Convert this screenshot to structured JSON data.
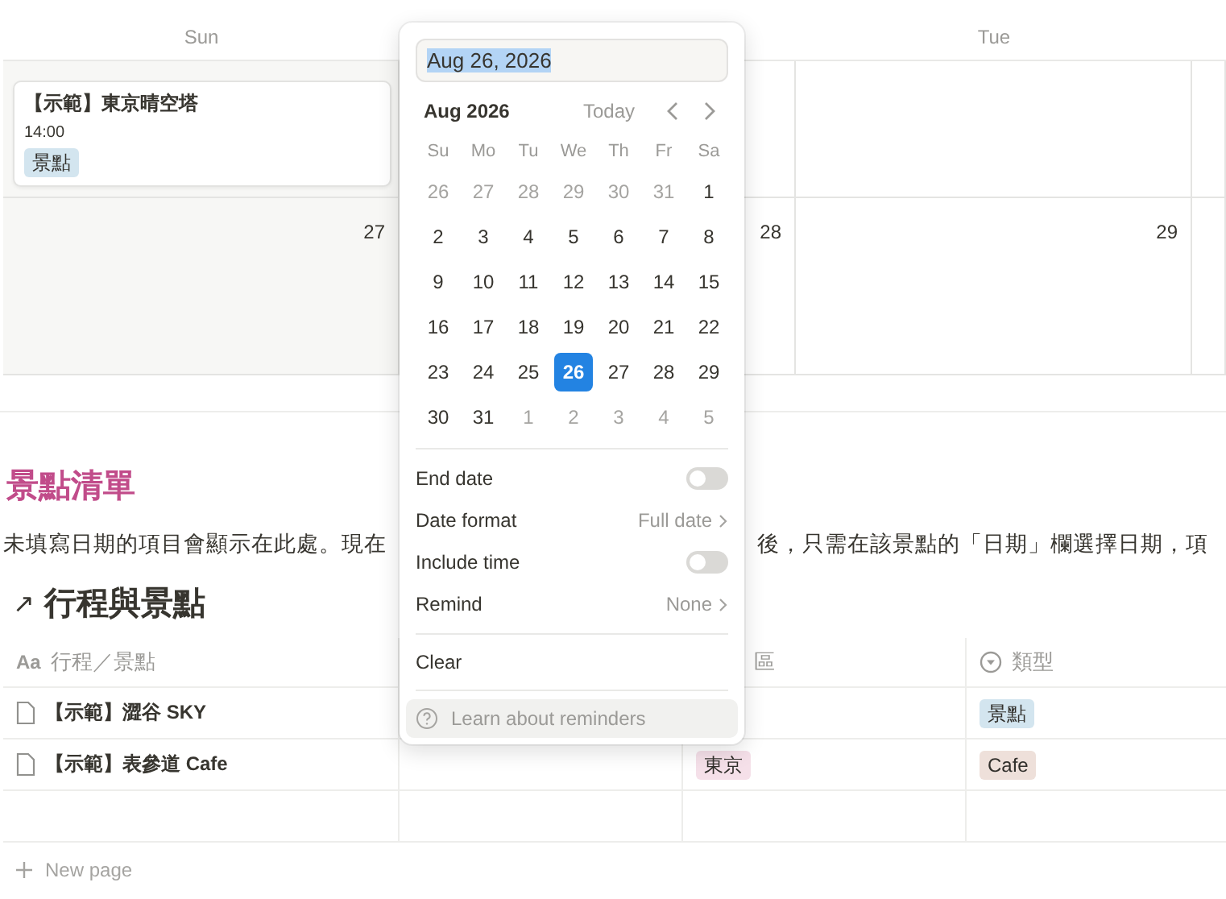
{
  "calendar": {
    "column_headers": [
      {
        "kind": "label",
        "label": "Sun"
      },
      {
        "kind": "covered"
      },
      {
        "kind": "label",
        "label": "Tue"
      },
      {
        "kind": "covered"
      }
    ],
    "weeks": [
      {
        "cells": [
          {
            "events": [
              {
                "title": "【示範】東京晴空塔",
                "time": "14:00",
                "tag": {
                  "label": "景點",
                  "color": "#d3e5ef"
                }
              }
            ]
          },
          {},
          {},
          {}
        ]
      },
      {
        "cells": [
          {
            "day": "27"
          },
          {
            "day": "28"
          },
          {
            "day": "29"
          },
          {}
        ]
      }
    ]
  },
  "date_popup": {
    "value": "Aug 26, 2026",
    "month": "Aug 2026",
    "today": "Today",
    "weekdays": [
      "Su",
      "Mo",
      "Tu",
      "We",
      "Th",
      "Fr",
      "Sa"
    ],
    "days": [
      {
        "label": "26",
        "muted": true,
        "selected": false
      },
      {
        "label": "27",
        "muted": true,
        "selected": false
      },
      {
        "label": "28",
        "muted": true,
        "selected": false
      },
      {
        "label": "29",
        "muted": true,
        "selected": false
      },
      {
        "label": "30",
        "muted": true,
        "selected": false
      },
      {
        "label": "31",
        "muted": true,
        "selected": false
      },
      {
        "label": "1",
        "muted": false,
        "selected": false
      },
      {
        "label": "2",
        "muted": false,
        "selected": false
      },
      {
        "label": "3",
        "muted": false,
        "selected": false
      },
      {
        "label": "4",
        "muted": false,
        "selected": false
      },
      {
        "label": "5",
        "muted": false,
        "selected": false
      },
      {
        "label": "6",
        "muted": false,
        "selected": false
      },
      {
        "label": "7",
        "muted": false,
        "selected": false
      },
      {
        "label": "8",
        "muted": false,
        "selected": false
      },
      {
        "label": "9",
        "muted": false,
        "selected": false
      },
      {
        "label": "10",
        "muted": false,
        "selected": false
      },
      {
        "label": "11",
        "muted": false,
        "selected": false
      },
      {
        "label": "12",
        "muted": false,
        "selected": false
      },
      {
        "label": "13",
        "muted": false,
        "selected": false
      },
      {
        "label": "14",
        "muted": false,
        "selected": false
      },
      {
        "label": "15",
        "muted": false,
        "selected": false
      },
      {
        "label": "16",
        "muted": false,
        "selected": false
      },
      {
        "label": "17",
        "muted": false,
        "selected": false
      },
      {
        "label": "18",
        "muted": false,
        "selected": false
      },
      {
        "label": "19",
        "muted": false,
        "selected": false
      },
      {
        "label": "20",
        "muted": false,
        "selected": false
      },
      {
        "label": "21",
        "muted": false,
        "selected": false
      },
      {
        "label": "22",
        "muted": false,
        "selected": false
      },
      {
        "label": "23",
        "muted": false,
        "selected": false
      },
      {
        "label": "24",
        "muted": false,
        "selected": false
      },
      {
        "label": "25",
        "muted": false,
        "selected": false
      },
      {
        "label": "26",
        "muted": false,
        "selected": true
      },
      {
        "label": "27",
        "muted": false,
        "selected": false
      },
      {
        "label": "28",
        "muted": false,
        "selected": false
      },
      {
        "label": "29",
        "muted": false,
        "selected": false
      },
      {
        "label": "30",
        "muted": false,
        "selected": false
      },
      {
        "label": "31",
        "muted": false,
        "selected": false
      },
      {
        "label": "1",
        "muted": true,
        "selected": false
      },
      {
        "label": "2",
        "muted": true,
        "selected": false
      },
      {
        "label": "3",
        "muted": true,
        "selected": false
      },
      {
        "label": "4",
        "muted": true,
        "selected": false
      },
      {
        "label": "5",
        "muted": true,
        "selected": false
      }
    ],
    "settings": [
      {
        "kind": "toggle",
        "label": "End date",
        "on": false
      },
      {
        "kind": "menu",
        "label": "Date format",
        "value": "Full date"
      },
      {
        "kind": "toggle",
        "label": "Include time",
        "on": false
      },
      {
        "kind": "menu",
        "label": "Remind",
        "value": "None"
      }
    ],
    "clear": "Clear",
    "help_link": "Learn about reminders"
  },
  "list_section": {
    "title": "景點清單",
    "description_left": "未填寫日期的項目會顯示在此處。現在",
    "description_right": "後，只需在該景點的「日期」欄選擇日期，項",
    "link_arrow": "↗",
    "heading": "行程與景點",
    "table": {
      "columns": [
        {
          "kind": "title",
          "icon_text": "Aa",
          "label": "行程／景點"
        },
        {
          "kind": "hidden"
        },
        {
          "kind": "plain",
          "label": "區"
        },
        {
          "kind": "select",
          "label": "類型"
        }
      ],
      "rows": [
        {
          "cells": [
            {
              "text": "【示範】澀谷 SKY"
            },
            {},
            {},
            {
              "tag": {
                "label": "景點",
                "color": "#d3e5ef"
              }
            }
          ]
        },
        {
          "cells": [
            {
              "text": "【示範】表參道 Cafe"
            },
            {},
            {
              "tag": {
                "label": "東京",
                "color": "#f5e0e9"
              }
            },
            {
              "tag": {
                "label": "Cafe",
                "color": "#eee0da"
              }
            }
          ]
        },
        {
          "cells": [
            {},
            {},
            {},
            {}
          ]
        }
      ]
    },
    "new_page": "New page"
  }
}
